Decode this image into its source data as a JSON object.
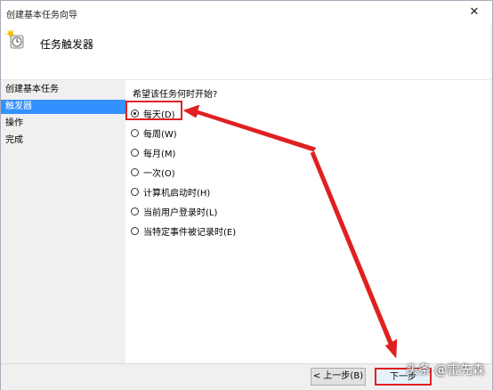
{
  "window": {
    "title": "创建基本任务向导",
    "close_glyph": "✕"
  },
  "header": {
    "title": "任务触发器",
    "icon": "clock-icon"
  },
  "sidebar": {
    "items": [
      {
        "label": "创建基本任务",
        "active": false
      },
      {
        "label": "触发器",
        "active": true
      },
      {
        "label": "操作",
        "active": false
      },
      {
        "label": "完成",
        "active": false
      }
    ]
  },
  "main": {
    "question": "希望该任务何时开始?",
    "options": [
      {
        "label": "每天(D)",
        "checked": true
      },
      {
        "label": "每周(W)",
        "checked": false
      },
      {
        "label": "每月(M)",
        "checked": false
      },
      {
        "label": "一次(O)",
        "checked": false
      },
      {
        "label": "计算机启动时(H)",
        "checked": false
      },
      {
        "label": "当前用户登录时(L)",
        "checked": false
      },
      {
        "label": "当特定事件被记录时(E)",
        "checked": false
      }
    ]
  },
  "footer": {
    "back_label": "< 上一步(B)",
    "next_label": "下一步"
  },
  "watermark": "头条 @雷先森",
  "colors": {
    "annotation": "#e02020",
    "selection": "#3390ff"
  }
}
